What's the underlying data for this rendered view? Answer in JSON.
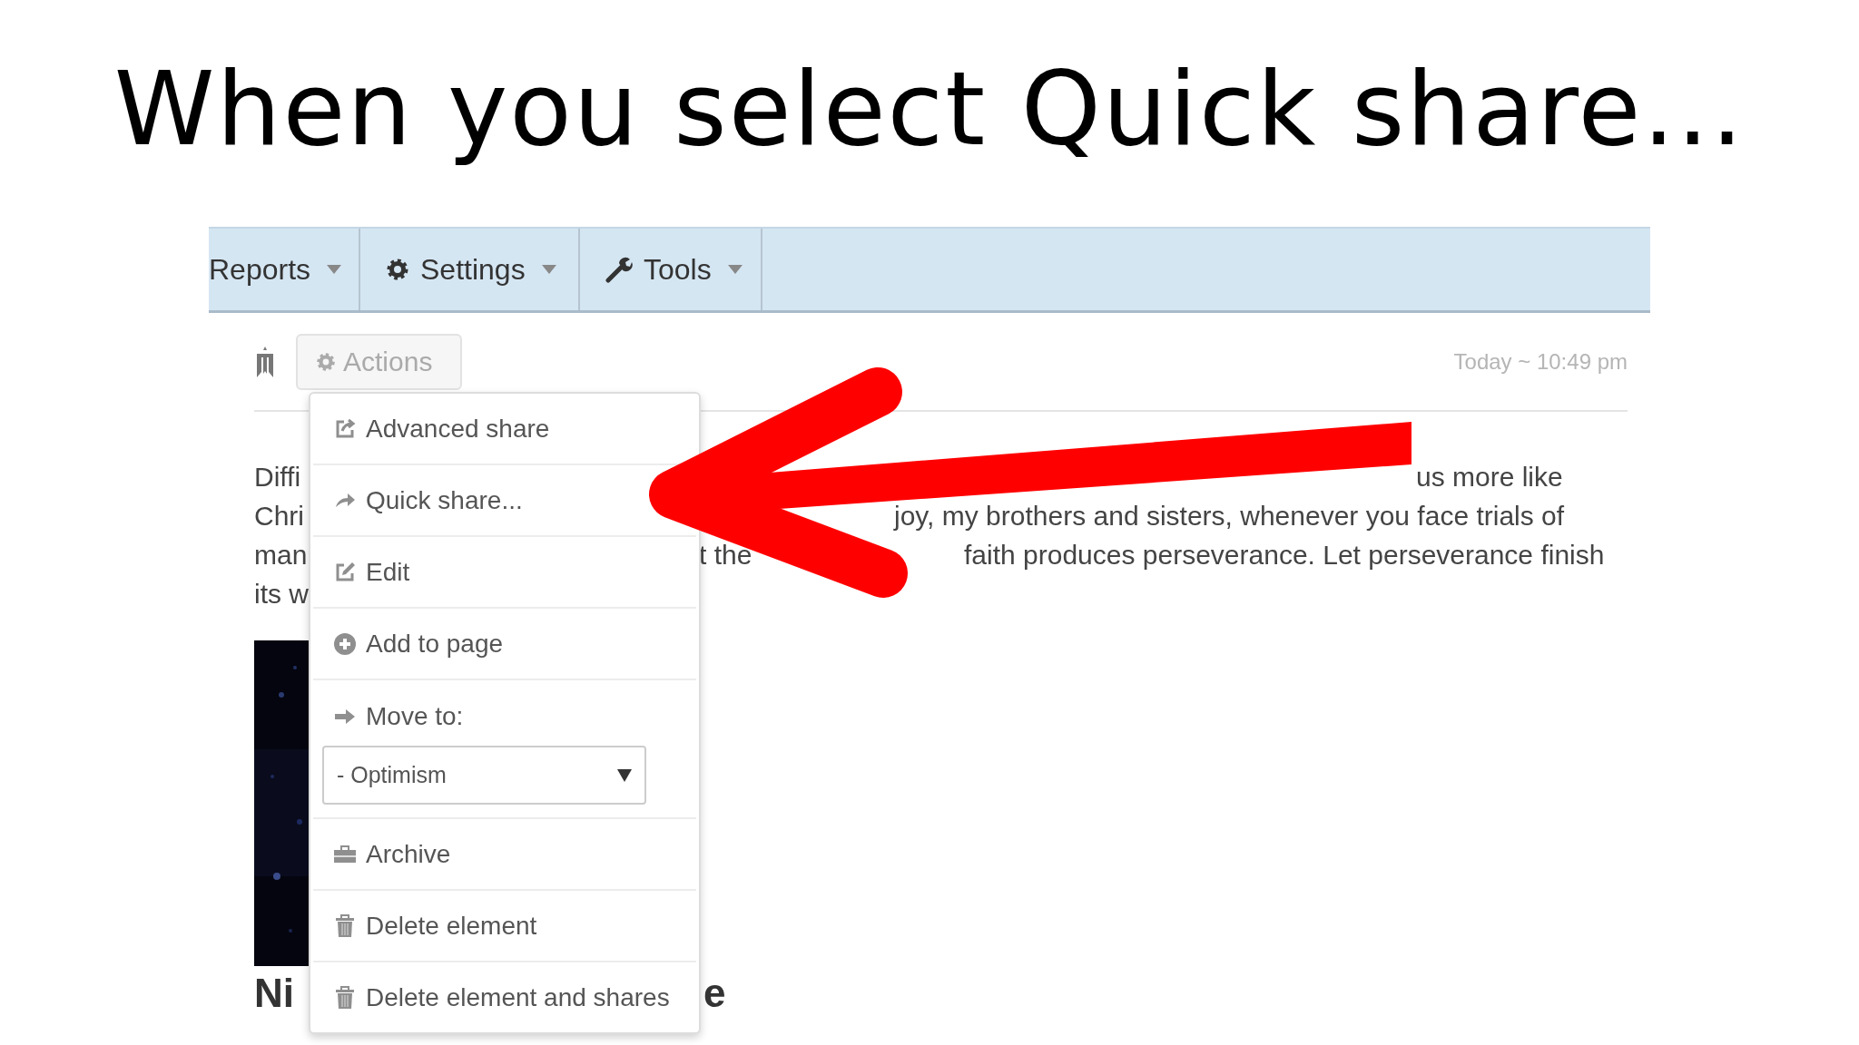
{
  "slide_title": "When you select Quick share...",
  "navbar": {
    "items": [
      {
        "label": "Reports",
        "kind": "plain"
      },
      {
        "label": "Settings",
        "kind": "gear"
      },
      {
        "label": "Tools",
        "kind": "wrench"
      }
    ]
  },
  "post": {
    "actions_button": "Actions",
    "timestamp": "Today ~ 10:49 pm",
    "text_lines": [
      {
        "left": "Diffi",
        "right": "us more like"
      },
      {
        "left": "Chri",
        "right": "joy, my brothers and sisters, whenever you face trials of"
      },
      {
        "left": "man",
        "right": "t the",
        "right_2": "faith produces perseverance. Let perseverance finish"
      },
      {
        "left": "its w"
      }
    ],
    "heading_left": "Ni",
    "heading_right": "e"
  },
  "menu": {
    "items": [
      {
        "kind": "item",
        "label": "Advanced share"
      },
      {
        "kind": "item",
        "label": "Quick share..."
      },
      {
        "kind": "item",
        "label": "Edit"
      },
      {
        "kind": "item",
        "label": "Add to page"
      },
      {
        "kind": "select",
        "label": "Move to:",
        "value": "- Optimism"
      },
      {
        "kind": "item",
        "label": "Archive"
      },
      {
        "kind": "item",
        "label": "Delete element"
      },
      {
        "kind": "item",
        "label": "Delete element and shares"
      }
    ]
  }
}
